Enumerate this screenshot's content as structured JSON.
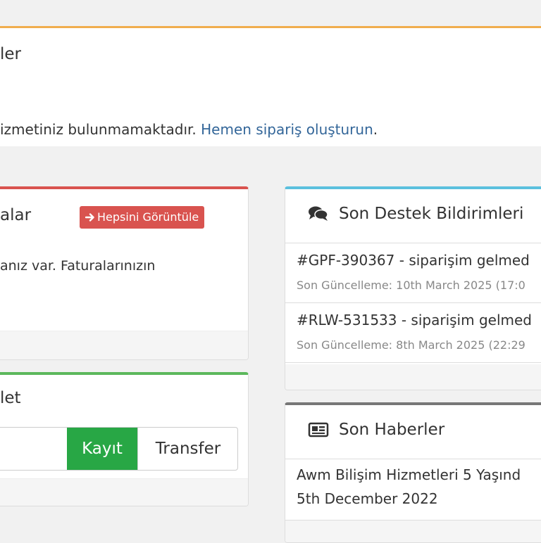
{
  "services": {
    "heading": "ler",
    "message": "izmetiniz bulunmamaktadır. ",
    "order_link": "Hemen sipariş oluşturun",
    "period": "."
  },
  "invoices": {
    "heading": "alar",
    "view_all_button": "Hepsini Görüntüle",
    "message": "anız var. Faturalarınızın"
  },
  "domain": {
    "heading": "let",
    "register_button": "Kayıt",
    "transfer_button": "Transfer"
  },
  "tickets": {
    "title": "Son Destek Bildirimleri",
    "items": [
      {
        "title": "#GPF-390367 - siparişim gelmed",
        "date": "Son Güncelleme: 10th March 2025 (17:0"
      },
      {
        "title": "#RLW-531533 - siparişim gelmed",
        "date": "Son Güncelleme: 8th March 2025 (22:29"
      }
    ]
  },
  "news": {
    "title": "Son Haberler",
    "items": [
      {
        "title": "Awm Bilişim Hizmetleri 5 Yaşınd",
        "date": "5th December 2022"
      }
    ]
  },
  "icons": {
    "view_all": "arrow-right-icon",
    "tickets": "comments-icon",
    "news": "newspaper-icon"
  },
  "colors": {
    "services_accent": "#f0ad4e",
    "invoices_accent": "#d9534f",
    "domain_accent": "#5cb85c",
    "tickets_accent": "#5bc0de",
    "news_accent": "#777777",
    "link": "#336699",
    "register_button": "#28a745"
  }
}
